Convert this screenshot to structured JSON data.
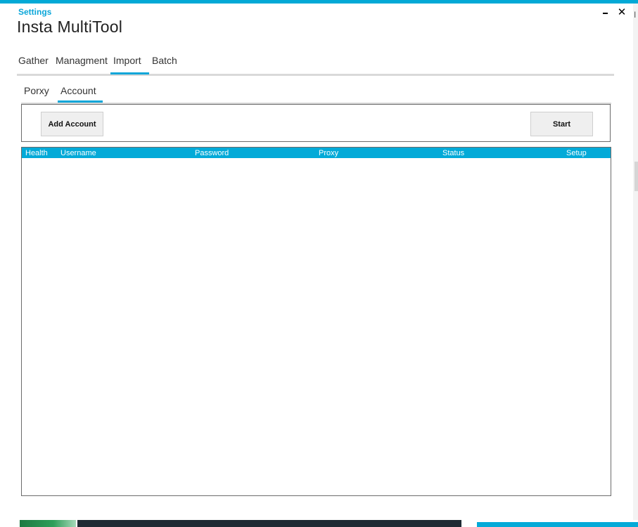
{
  "window": {
    "settings_label": "Settings",
    "title": "Insta MultiTool",
    "minimize_glyph": "",
    "close_glyph": "✕"
  },
  "main_tabs": [
    {
      "label": "Gather",
      "active": false
    },
    {
      "label": "Managment",
      "active": false
    },
    {
      "label": "Import",
      "active": true
    },
    {
      "label": "Batch",
      "active": false
    }
  ],
  "sub_tabs": [
    {
      "label": "Porxy",
      "active": false
    },
    {
      "label": "Account",
      "active": true
    }
  ],
  "toolbar": {
    "add_account_label": "Add Account",
    "start_label": "Start"
  },
  "grid": {
    "columns": [
      "Health",
      "Username",
      "Password",
      "Proxy",
      "Status",
      "Setup"
    ],
    "rows": []
  },
  "colors": {
    "accent": "#03a9d6",
    "tab_underline": "#d9d9d9",
    "button_bg": "#efefef"
  }
}
